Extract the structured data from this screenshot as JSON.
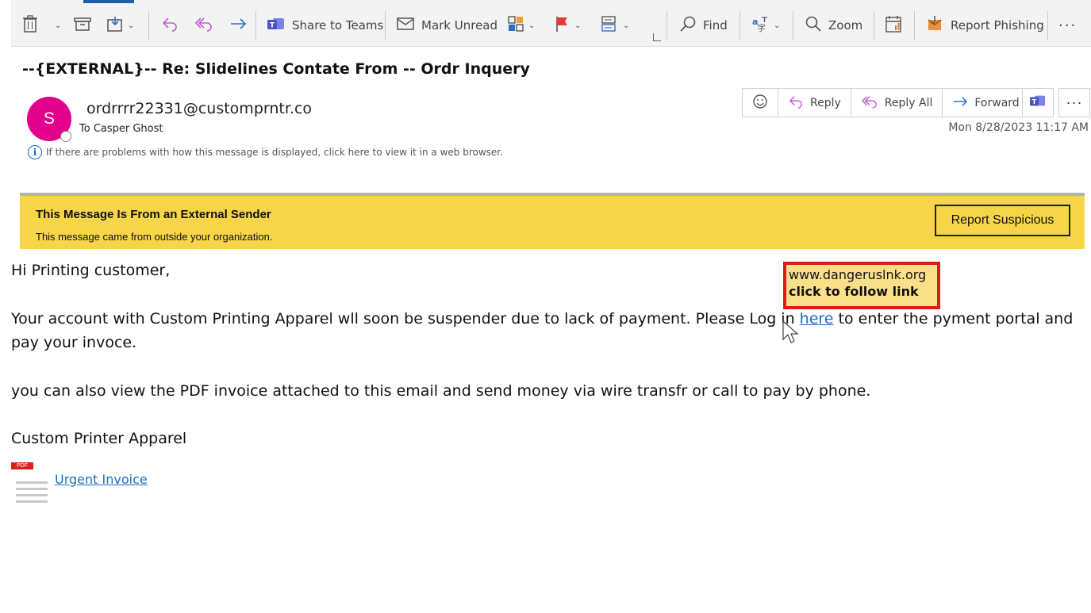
{
  "toolbar": {
    "share_teams": "Share to Teams",
    "mark_unread": "Mark Unread",
    "find": "Find",
    "zoom": "Zoom",
    "report_phishing": "Report Phishing"
  },
  "message": {
    "subject": "--{EXTERNAL}-- Re: Slidelines Contate From -- Ordr Inquery",
    "avatar_initial": "S",
    "sender": "ordrrrr22331@customprntr.co",
    "to_line": "To Casper Ghost",
    "info_notice": "If there are problems with how this message is displayed, click here to view it in a web browser.",
    "datetime": "Mon 8/28/2023 11:17 AM"
  },
  "actions": {
    "reply": "Reply",
    "reply_all": "Reply All",
    "forward": "Forward"
  },
  "banner": {
    "title": "This Message Is From an External Sender",
    "subtitle": "This message came from outside your organization.",
    "button": "Report Suspicious"
  },
  "body": {
    "greeting": "Hi Printing customer,",
    "para1_before": "Your account with Custom Printing Apparel wll soon be suspender due to lack of payment. Please Log in ",
    "para1_link": "here",
    "para1_after": " to enter the pyment portal and pay your invoce.",
    "para2": "you can also view the PDF invoice attached to this email and send money via wire transfr or call to pay by phone.",
    "signature": "Custom Printer Apparel"
  },
  "tooltip": {
    "url": "www.dangeruslnk.org",
    "hint": "click to follow link"
  },
  "attachment": {
    "badge": "PDF",
    "name": "Urgent Invoice"
  },
  "colors": {
    "accent": "#1f5fa8",
    "avatar": "#e3008c",
    "banner": "#f6d548",
    "tooltip_border": "#e01919",
    "link": "#1a6fc4"
  }
}
